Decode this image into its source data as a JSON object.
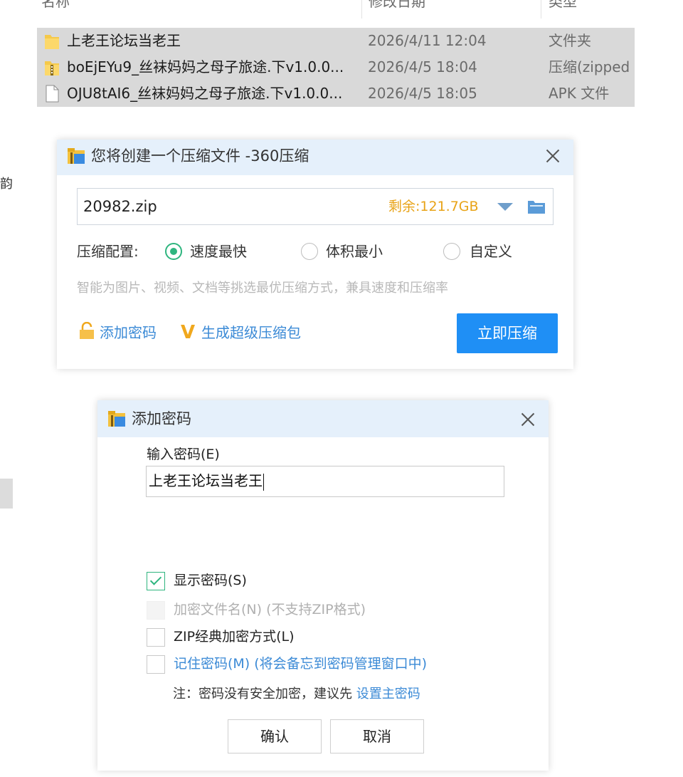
{
  "explorer": {
    "columns": {
      "name": "名称",
      "modified": "修改日期",
      "type": "类型"
    },
    "files": [
      {
        "name": "上老王论坛当老王",
        "modified": "2026/4/11 12:04",
        "type": "文件夹",
        "icon": "folder-icon"
      },
      {
        "name": "boEjEYu9_丝袜妈妈之母子旅途.下v1.0.0...",
        "modified": "2026/4/5 18:04",
        "type": "压缩(zipped",
        "icon": "zip-folder-icon"
      },
      {
        "name": "OJU8tAI6_丝袜妈妈之母子旅途.下v1.0.0...",
        "modified": "2026/4/5 18:05",
        "type": "APK 文件",
        "icon": "file-icon"
      }
    ],
    "left_glyph": "韵"
  },
  "compress_dialog": {
    "title": "您将创建一个压缩文件 -360压缩",
    "filename": "20982.zip",
    "free_space": "剩余:121.7GB",
    "config_label": "压缩配置:",
    "options": [
      {
        "label": "速度最快",
        "selected": true
      },
      {
        "label": "体积最小",
        "selected": false
      },
      {
        "label": "自定义",
        "selected": false
      }
    ],
    "description": "智能为图片、视频、文档等挑选最优压缩方式，兼具速度和压缩率",
    "add_password_link": "添加密码",
    "super_pack_link": "生成超级压缩包",
    "compress_button": "立即压缩",
    "accent_color": "#1f8ff5"
  },
  "password_dialog": {
    "title": "添加密码",
    "input_label": "输入密码(E)",
    "password_value": "上老王论坛当老王",
    "checkboxes": [
      {
        "label": "显示密码(S)",
        "checked": true,
        "disabled": false,
        "link": false
      },
      {
        "label": "加密文件名(N) (不支持ZIP格式)",
        "checked": false,
        "disabled": true,
        "link": false
      },
      {
        "label": "ZIP经典加密方式(L)",
        "checked": false,
        "disabled": false,
        "link": false
      },
      {
        "label": "记住密码(M) (将会备忘到密码管理窗口中)",
        "checked": false,
        "disabled": false,
        "link": true
      }
    ],
    "note_prefix": "注：密码没有安全加密，建议先",
    "note_link": "设置主密码",
    "ok_button": "确认",
    "cancel_button": "取消"
  }
}
